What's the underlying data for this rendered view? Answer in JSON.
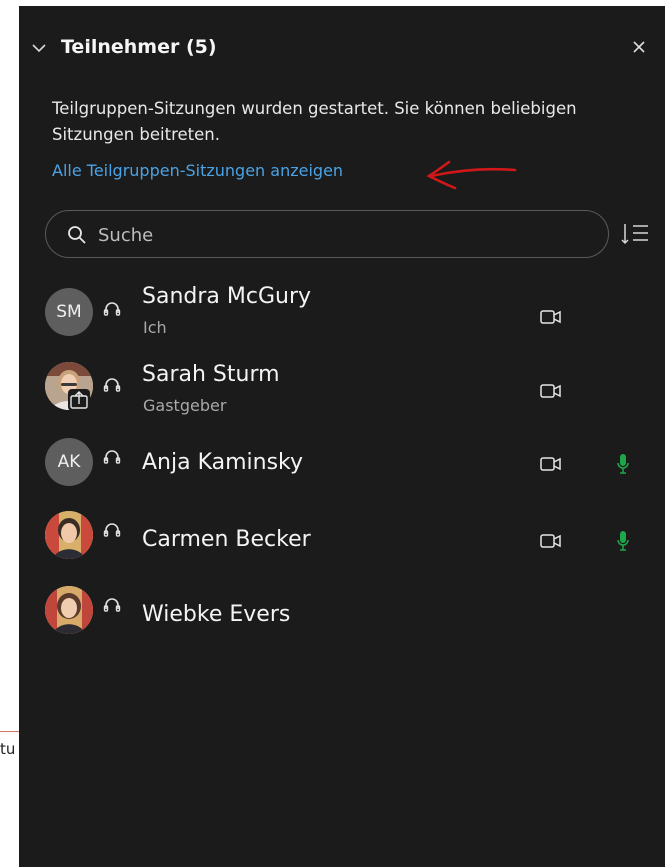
{
  "background": {
    "snippet": "tu"
  },
  "panel": {
    "title": "Teilnehmer (5)",
    "notice": "Teilgruppen-Sitzungen wurden gestartet. Sie können beliebigen Sitzungen beitreten.",
    "link": "Alle Teilgruppen-Sitzungen anzeigen",
    "search_placeholder": "Suche"
  },
  "participants": [
    {
      "initials": "SM",
      "name": "Sandra McGury",
      "role": "Ich",
      "avatar": "initials",
      "video": true,
      "mic_active": false,
      "sharing": false
    },
    {
      "initials": "",
      "name": "Sarah Sturm",
      "role": "Gastgeber",
      "avatar": "photo",
      "video": true,
      "mic_active": false,
      "sharing": true
    },
    {
      "initials": "AK",
      "name": "Anja Kaminsky",
      "role": "",
      "avatar": "initials",
      "video": true,
      "mic_active": true,
      "sharing": false
    },
    {
      "initials": "",
      "name": "Carmen Becker",
      "role": "",
      "avatar": "photo",
      "video": true,
      "mic_active": true,
      "sharing": false
    },
    {
      "initials": "",
      "name": "Wiebke Evers",
      "role": "",
      "avatar": "photo",
      "video": false,
      "mic_active": false,
      "sharing": false
    }
  ],
  "colors": {
    "panel": "#1b1b1b",
    "link": "#4aa3e6",
    "mic_active": "#1fa64a",
    "annotation": "#d01818"
  }
}
